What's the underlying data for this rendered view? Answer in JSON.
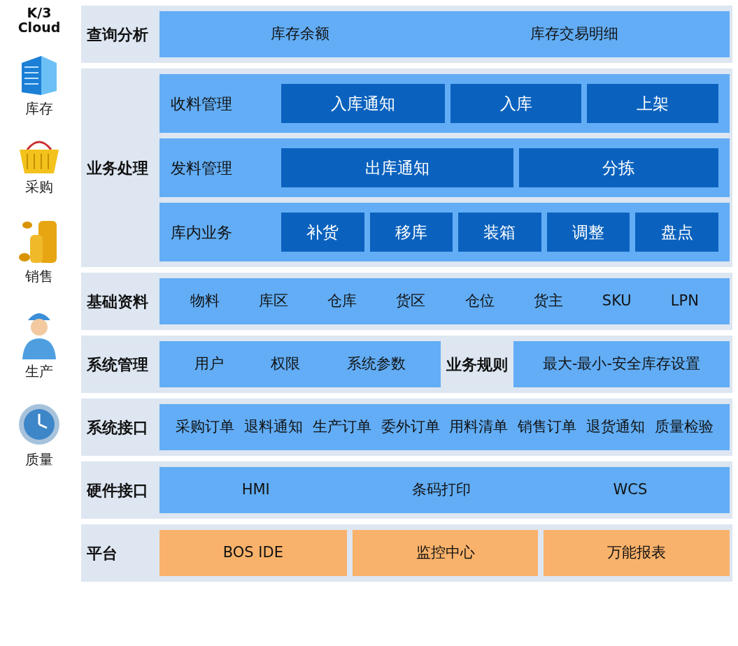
{
  "logo": [
    "K/3",
    "Cloud"
  ],
  "modules": [
    {
      "label": "库存"
    },
    {
      "label": "采购"
    },
    {
      "label": "销售"
    },
    {
      "label": "生产"
    },
    {
      "label": "质量"
    }
  ],
  "sections": [
    {
      "kind": "flat",
      "title": "查询分析",
      "items": [
        "库存余额",
        "库存交易明细"
      ]
    },
    {
      "kind": "groups",
      "title": "业务处理",
      "groups": [
        {
          "title": "收料管理",
          "items": [
            "入库通知",
            "入库",
            "上架"
          ]
        },
        {
          "title": "发料管理",
          "items": [
            "出库通知",
            "分拣"
          ]
        },
        {
          "title": "库内业务",
          "items": [
            "补货",
            "移库",
            "装箱",
            "调整",
            "盘点"
          ]
        }
      ]
    },
    {
      "kind": "flat",
      "title": "基础资料",
      "items": [
        "物料",
        "库区",
        "仓库",
        "货区",
        "仓位",
        "货主",
        "SKU",
        "LPN"
      ]
    },
    {
      "kind": "split",
      "parts": [
        {
          "title": "系统管理",
          "items": [
            "用户",
            "权限",
            "系统参数"
          ]
        },
        {
          "title": "业务规则",
          "items": [
            "最大-最小-安全库存设置"
          ]
        }
      ]
    },
    {
      "kind": "flat",
      "title": "系统接口",
      "items": [
        "采购订单",
        "退料通知",
        "生产订单",
        "委外订单",
        "用料清单",
        "销售订单",
        "退货通知",
        "质量检验"
      ]
    },
    {
      "kind": "flat",
      "title": "硬件接口",
      "items": [
        "HMI",
        "条码打印",
        "WCS"
      ]
    },
    {
      "kind": "tiles",
      "title": "平台",
      "items": [
        "BOS IDE",
        "监控中心",
        "万能报表"
      ]
    }
  ]
}
